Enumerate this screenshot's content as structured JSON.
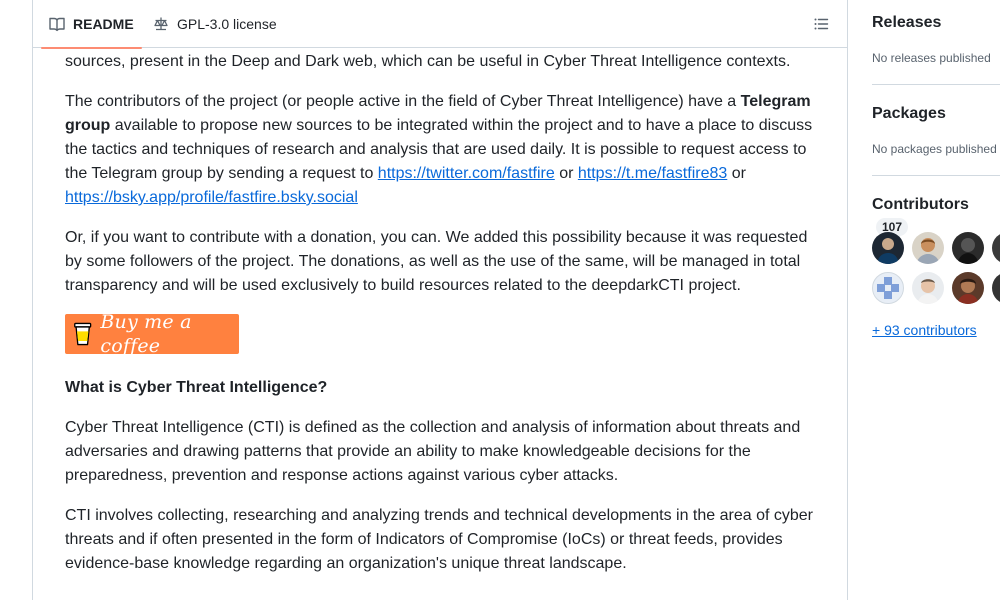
{
  "readme_tabs": {
    "readme_label": "README",
    "license_label": "GPL-3.0 license"
  },
  "readme": {
    "p0": "sources, present in the Deep and Dark web, which can be useful in Cyber Threat Intelligence contexts.",
    "p1_a": "The contributors of the project (or people active in the field of Cyber Threat Intelligence) have a ",
    "p1_bold": "Telegram group",
    "p1_b": " available to propose new sources to be integrated within the project and to have a place to discuss the tactics and techniques of research and analysis that are used daily. It is possible to request access to the Telegram group by sending a request to ",
    "link_twitter": "https://twitter.com/fastfire",
    "or1": " or ",
    "link_telegram": "https://t.me/fastfire83",
    "or2": " or ",
    "link_bsky": "https://bsky.app/profile/fastfire.bsky.social",
    "p2": "Or, if you want to contribute with a donation, you can. We added this possibility because it was requested by some followers of the project. The donations, as well as the use of the same, will be managed in total transparency and will be used exclusively to build resources related to the deepdarkCTI project.",
    "coffee_label": "Buy me a coffee",
    "heading_cti": "What is Cyber Threat Intelligence?",
    "p3": "Cyber Threat Intelligence (CTI) is defined as the collection and analysis of information about threats and adversaries and drawing patterns that provide an ability to make knowledgeable decisions for the preparedness, prevention and response actions against various cyber attacks.",
    "p4": "CTI involves collecting, researching and analyzing trends and technical developments in the area of cyber threats and if often presented in the form of Indicators of Compromise (IoCs) or threat feeds, provides evidence-base knowledge regarding an organization's unique threat landscape."
  },
  "sidebar": {
    "releases_title": "Releases",
    "releases_text": "No releases published",
    "packages_title": "Packages",
    "packages_text": "No packages published",
    "contributors_title": "Contributors",
    "contributors_count": "107",
    "more_contributors": "+ 93 contributors"
  },
  "colors": {
    "link": "#0969da",
    "tab_underline": "#fd8c73",
    "coffee_bg": "#ff813f",
    "border": "#d1d9e0"
  },
  "icons": [
    "book-icon",
    "law-icon",
    "list-unordered-icon",
    "coffee-cup-icon"
  ]
}
